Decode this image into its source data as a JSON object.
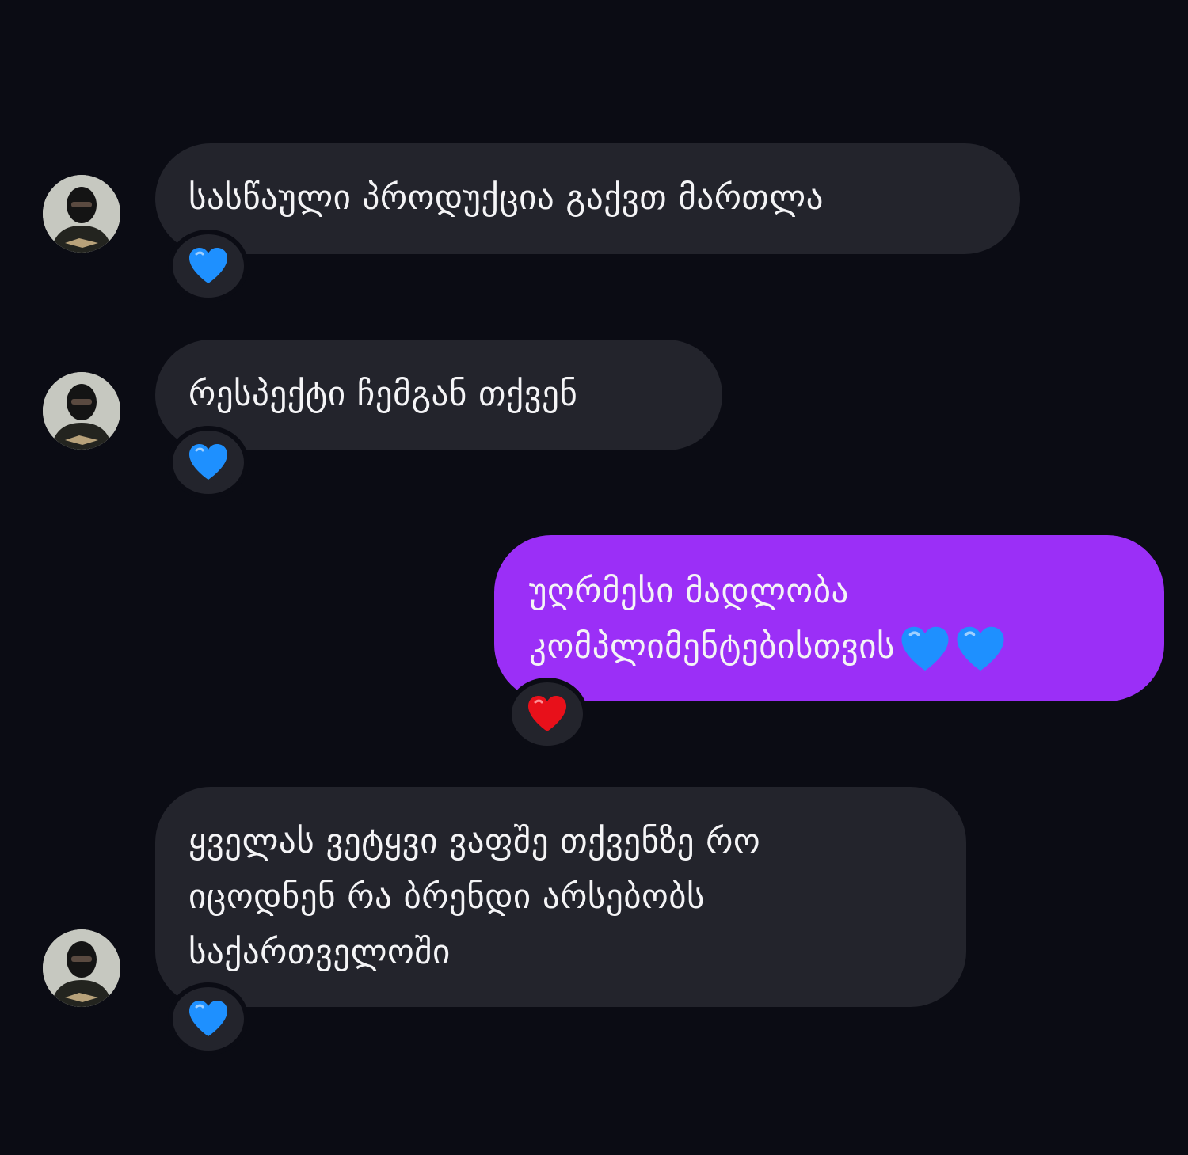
{
  "messages": [
    {
      "direction": "incoming",
      "lines": [
        "სასწაული პროდუქცია გაქვთ მართლა"
      ],
      "reaction": "blue-heart"
    },
    {
      "direction": "incoming",
      "lines": [
        "რესპექტი ჩემგან თქვენ"
      ],
      "reaction": "blue-heart"
    },
    {
      "direction": "outgoing",
      "lines": [
        "უღრმესი მადლობა",
        "კომპლიმენტებისთვის"
      ],
      "trailing_icons": [
        "blue-heart",
        "blue-heart"
      ],
      "reaction": "red-heart"
    },
    {
      "direction": "incoming",
      "lines": [
        "ყველას ვეტყვი ვაფშე თქვენზე რო",
        "იცოდნენ რა ბრენდი არსებობს",
        "საქართველოში"
      ],
      "reaction": "blue-heart"
    }
  ],
  "colors": {
    "background": "#0b0c14",
    "incoming_bubble": "#23242c",
    "outgoing_bubble": "#9b2ff7",
    "blue_heart": "#1e90ff",
    "red_heart": "#e8101a"
  }
}
